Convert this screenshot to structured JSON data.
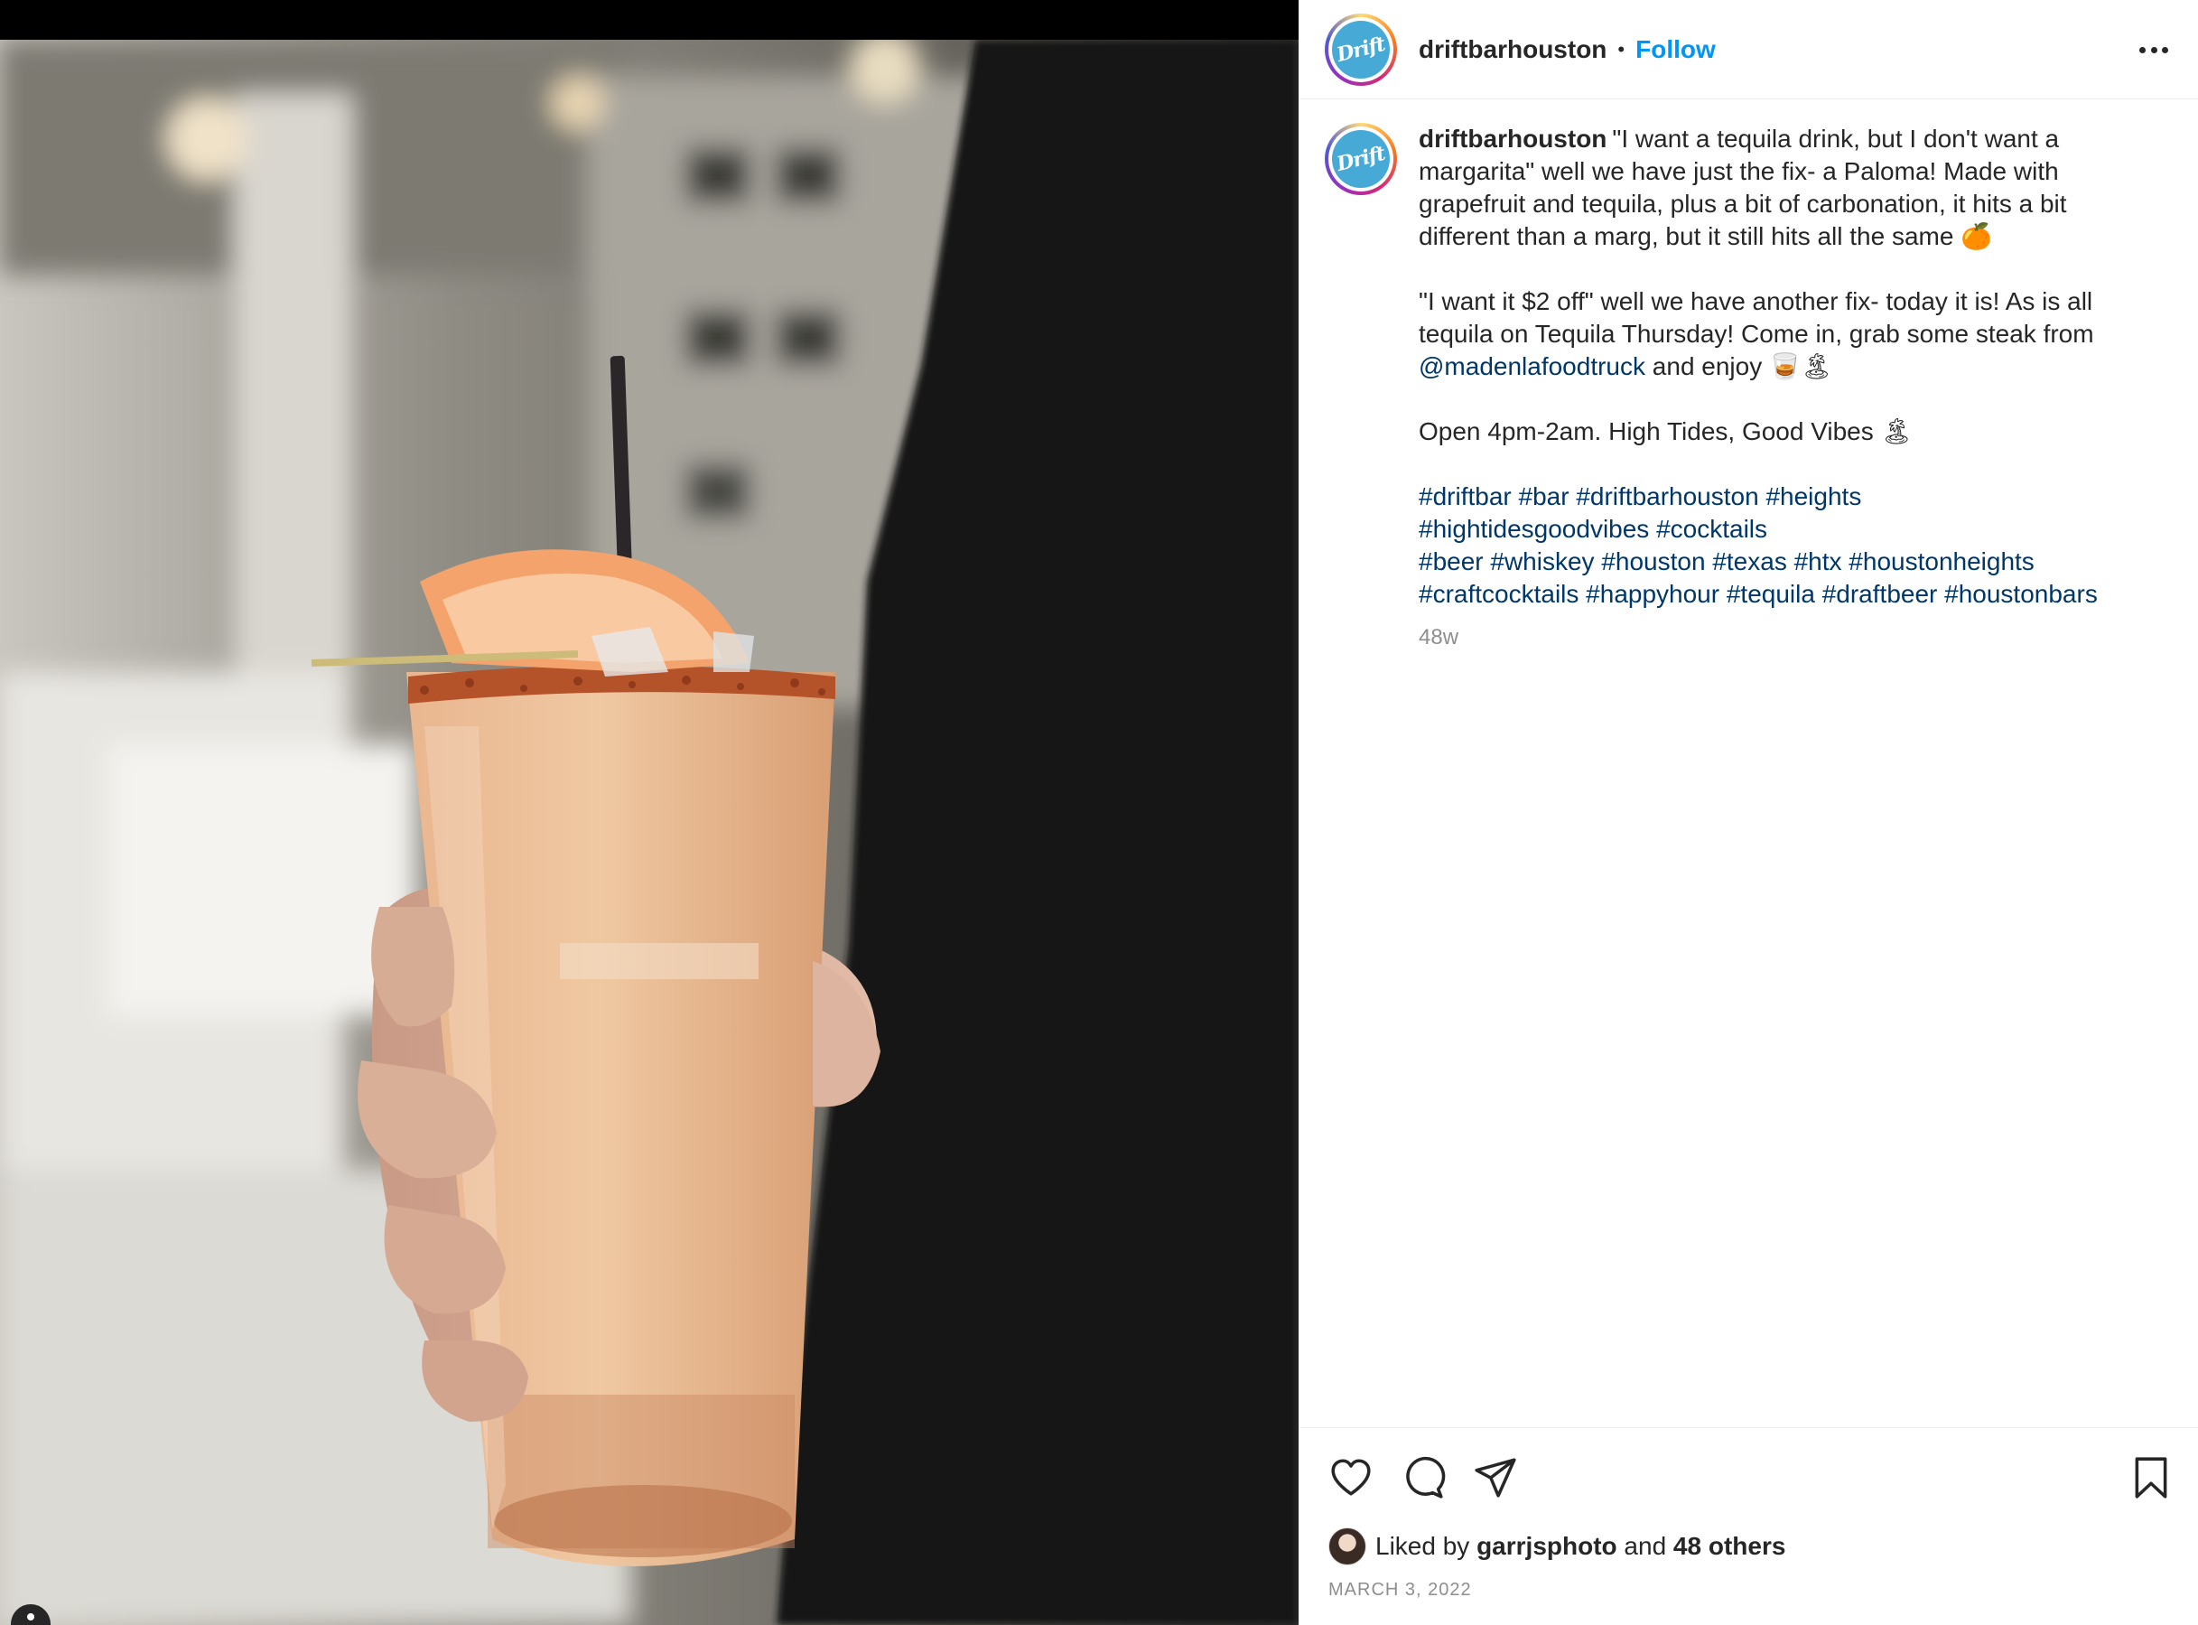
{
  "post": {
    "username": "driftbarhouston",
    "avatar_text": "Drift",
    "separator": "•",
    "follow_label": "Follow",
    "more_icon": "more-horizontal-icon"
  },
  "caption": {
    "username": "driftbarhouston",
    "p1": "\"I want a tequila drink, but I don't want a margarita\" well we have just the fix- a Paloma! Made with grapefruit and tequila, plus a bit of carbonation, it hits a bit different than a marg, but it still hits all the same 🍊",
    "p2_before": "\"I want it $2 off\" well we have another fix- today it is! As is all tequila on Tequila Thursday! Come in, grab some steak from ",
    "p2_mention": "@madenlafoodtruck",
    "p2_after": " and enjoy 🥃🏝",
    "p3": "Open 4pm-2am. High Tides, Good Vibes 🏝",
    "hashtag_lines": [
      "#driftbar #bar #driftbarhouston #heights",
      "#hightidesgoodvibes #cocktails",
      "#beer #whiskey #houston #texas #htx #houstonheights",
      "#craftcocktails #happyhour #tequila #draftbeer #houstonbars"
    ],
    "time_ago": "48w"
  },
  "actions": {
    "icons": [
      "heart-icon",
      "comment-icon",
      "share-icon",
      "bookmark-icon"
    ]
  },
  "likes": {
    "prefix": "Liked by",
    "user": "garrjsphoto",
    "middle": "and",
    "others": "48 others"
  },
  "date": "MARCH 3, 2022",
  "colors": {
    "accent_blue": "#0095f6",
    "link_blue": "#00376b",
    "brand_logo": "#47a9d6",
    "muted_gray": "#8e8e8e"
  }
}
